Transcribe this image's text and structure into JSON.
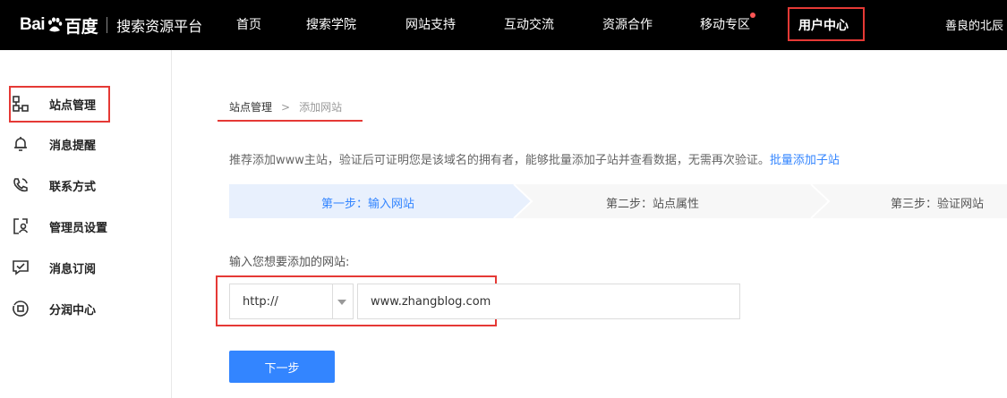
{
  "header": {
    "logo_text_left": "Bai",
    "logo_text_right": "百度",
    "site_name": "搜索资源平台",
    "nav": [
      {
        "label": "首页"
      },
      {
        "label": "搜索学院"
      },
      {
        "label": "网站支持"
      },
      {
        "label": "互动交流"
      },
      {
        "label": "资源合作"
      },
      {
        "label": "移动专区"
      }
    ],
    "active_nav": "用户中心",
    "user_name": "善良的北辰"
  },
  "sidebar": {
    "items": [
      {
        "label": "站点管理",
        "icon": "site-tree-icon"
      },
      {
        "label": "消息提醒",
        "icon": "bell-icon"
      },
      {
        "label": "联系方式",
        "icon": "phone-icon"
      },
      {
        "label": "管理员设置",
        "icon": "admin-icon"
      },
      {
        "label": "消息订阅",
        "icon": "subscribe-icon"
      },
      {
        "label": "分润中心",
        "icon": "revenue-icon"
      }
    ]
  },
  "breadcrumb": {
    "parent": "站点管理",
    "separator": ">",
    "current": "添加网站"
  },
  "tip": {
    "text": "推荐添加www主站，验证后可证明您是该域名的拥有者，能够批量添加子站并查看数据，无需再次验证。",
    "link": "批量添加子站"
  },
  "steps": [
    {
      "label": "第一步：输入网站",
      "active": true
    },
    {
      "label": "第二步：站点属性",
      "active": false
    },
    {
      "label": "第三步：验证网站",
      "active": false
    }
  ],
  "form": {
    "label": "输入您想要添加的网站:",
    "protocol": "http://",
    "url_value": "www.zhangblog.com",
    "next_button": "下一步"
  },
  "colors": {
    "accent": "#3385ff",
    "highlight": "#e53935",
    "active_step_bg": "#e8f0fd"
  }
}
